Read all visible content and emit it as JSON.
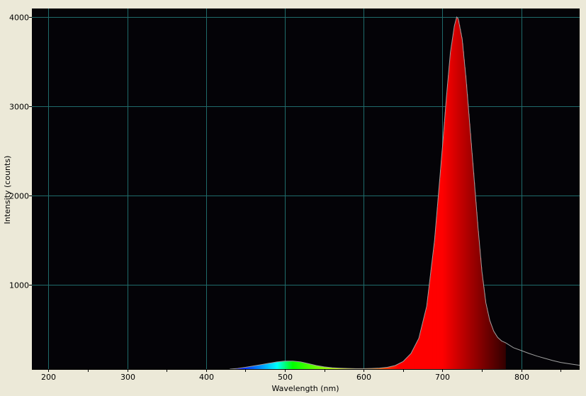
{
  "chart_data": {
    "type": "area",
    "title": "",
    "xlabel": "Wavelength (nm)",
    "ylabel": "Intensity (counts)",
    "xlim": [
      179,
      874
    ],
    "ylim": [
      55,
      4095
    ],
    "x_ticks": [
      200,
      300,
      400,
      500,
      600,
      700,
      800
    ],
    "y_ticks": [
      1000,
      2000,
      3000,
      4000
    ],
    "grid": true,
    "colors": {
      "background": "#040307",
      "grid": "#1f6b6b",
      "outline": "#a0a0a0",
      "frame": "#ece9d8"
    },
    "fill": "visible-spectrum color under curve from 380 to 780 nm",
    "series": [
      {
        "name": "spectrum",
        "x": [
          430,
          440,
          450,
          460,
          470,
          480,
          490,
          500,
          510,
          520,
          530,
          540,
          550,
          560,
          570,
          580,
          590,
          600,
          610,
          620,
          630,
          640,
          650,
          660,
          670,
          680,
          690,
          700,
          705,
          710,
          715,
          718,
          720,
          725,
          730,
          735,
          740,
          745,
          750,
          755,
          760,
          765,
          770,
          775,
          780,
          790,
          800,
          810,
          820,
          830,
          840,
          850,
          860,
          870,
          874
        ],
        "y": [
          55,
          62,
          75,
          90,
          105,
          120,
          135,
          145,
          145,
          135,
          115,
          95,
          80,
          70,
          65,
          62,
          60,
          60,
          62,
          66,
          75,
          95,
          140,
          230,
          400,
          760,
          1500,
          2550,
          3100,
          3600,
          3900,
          4000,
          3980,
          3750,
          3300,
          2750,
          2200,
          1650,
          1150,
          800,
          600,
          480,
          410,
          370,
          350,
          295,
          262,
          230,
          200,
          175,
          150,
          130,
          115,
          103,
          98
        ]
      }
    ]
  }
}
